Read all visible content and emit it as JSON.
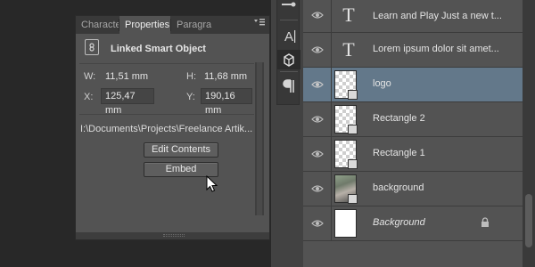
{
  "properties_panel": {
    "tabs": [
      {
        "label": "Characte"
      },
      {
        "label": "Properties"
      },
      {
        "label": "Paragra"
      }
    ],
    "menu_glyph": "≡",
    "title": "Linked Smart Object",
    "w_label": "W:",
    "w_value": "11,51 mm",
    "h_label": "H:",
    "h_value": "11,68 mm",
    "x_label": "X:",
    "x_value": "125,47 mm",
    "y_label": "Y:",
    "y_value": "190,16 mm",
    "path": "I:\\Documents\\Projects\\Freelance Artik...",
    "edit_contents_label": "Edit Contents",
    "embed_label": "Embed"
  },
  "tools": {
    "items": [
      "brush-tool",
      "character-tool",
      "3d-tool",
      "paragraph-tool"
    ]
  },
  "layers_panel": {
    "rows": [
      {
        "name": "Learn and Play Just a new t...",
        "kind": "text",
        "italic": false
      },
      {
        "name": "Lorem ipsum dolor sit amet...",
        "kind": "text",
        "italic": false
      },
      {
        "name": "logo",
        "kind": "smart-object",
        "italic": false,
        "selected": true
      },
      {
        "name": "Rectangle 2",
        "kind": "smart-object",
        "italic": false
      },
      {
        "name": "Rectangle 1",
        "kind": "smart-object",
        "italic": false
      },
      {
        "name": "background",
        "kind": "photo",
        "italic": false
      },
      {
        "name": "Background",
        "kind": "white",
        "italic": true,
        "locked": true
      }
    ]
  },
  "colors": {
    "panel": "#535353",
    "selection": "#63788a",
    "background": "#282828"
  }
}
